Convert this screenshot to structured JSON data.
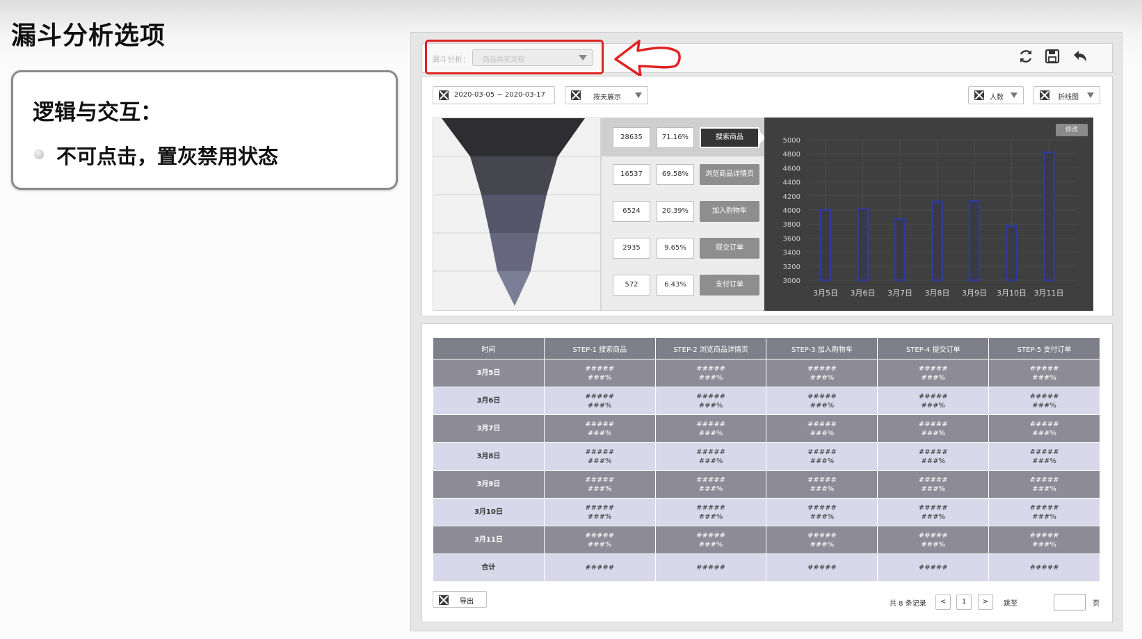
{
  "slide": {
    "title": "漏斗分析选项",
    "note": {
      "heading": "逻辑与交互：",
      "bullet": "不可点击，置灰禁用状态"
    }
  },
  "toolbar": {
    "dropdown_label": "漏斗分析：",
    "dropdown_value": "商品购买流程",
    "icons": [
      "refresh-icon",
      "save-icon",
      "undo-icon"
    ],
    "highlight_color": "#e02222"
  },
  "filters": {
    "date_range": "2020-03-05 ~ 2020-03-17",
    "granularity": "按天展示",
    "metric": "人数",
    "chart_type": "折线图"
  },
  "funnel": {
    "steps": [
      {
        "count": "28635",
        "rate": "71.16%",
        "name": "搜索商品"
      },
      {
        "count": "16537",
        "rate": "69.58%",
        "name": "浏览商品详情页"
      },
      {
        "count": "6524",
        "rate": "20.39%",
        "name": "加入购物车"
      },
      {
        "count": "2935",
        "rate": "9.65%",
        "name": "提交订单"
      },
      {
        "count": "572",
        "rate": "6.43%",
        "name": "支付订单"
      }
    ]
  },
  "chart": {
    "edit_label": "修改"
  },
  "chart_data": {
    "type": "bar",
    "categories": [
      "3月5日",
      "3月6日",
      "3月7日",
      "3月8日",
      "3月9日",
      "3月10日",
      "3月11日"
    ],
    "values": [
      4000,
      4020,
      3870,
      4120,
      4130,
      3770,
      4820
    ],
    "ylim": [
      3000,
      5000
    ],
    "yticks": [
      "5000",
      "4800",
      "4600",
      "4400",
      "4200",
      "4000",
      "3800",
      "3600",
      "3400",
      "3200",
      "3000"
    ],
    "bar_color": "#2f3a9e",
    "grid": true
  },
  "table": {
    "headers": [
      "时间",
      "STEP-1 搜索商品",
      "STEP-2 浏览商品详情页",
      "STEP-3 加入购物车",
      "STEP-4 提交订单",
      "STEP-5 支付订单"
    ],
    "cell_value": "#####",
    "cell_pct": "###%",
    "rows": [
      {
        "time": "3月5日"
      },
      {
        "time": "3月6日"
      },
      {
        "time": "3月7日"
      },
      {
        "time": "3月8日"
      },
      {
        "time": "3月9日"
      },
      {
        "time": "3月10日"
      },
      {
        "time": "3月11日"
      }
    ],
    "total_label": "合计",
    "total_value": "#####"
  },
  "footer": {
    "export_label": "导出",
    "records_text": "共 8 条记录",
    "prev": "<",
    "page": "1",
    "next": ">",
    "jump_label": "跳至",
    "page_unit": "页"
  }
}
